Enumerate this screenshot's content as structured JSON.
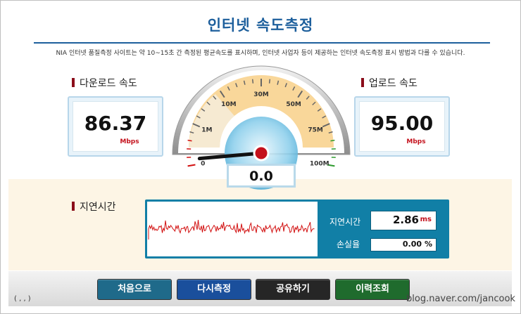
{
  "page": {
    "title": "인터넷 속도측정",
    "description": "NIA 인터넷 품질측정 사이트는 약 10~15초 간 측정된 평균속도를 표시하며, 인터넷 사업자 등이 제공하는 인터넷 속도측정 표시 방법과 다를 수 있습니다."
  },
  "download": {
    "label": "다운로드 속도",
    "value": "86.37",
    "unit": "Mbps"
  },
  "upload": {
    "label": "업로드 속도",
    "value": "95.00",
    "unit": "Mbps"
  },
  "gauge": {
    "ticks": [
      "0",
      "1M",
      "10M",
      "30M",
      "50M",
      "75M",
      "100M"
    ],
    "current_value": "0.0",
    "needle_level": 0.0
  },
  "latency": {
    "label": "지연시간",
    "stat_label": "지연시간",
    "value": "2.86",
    "unit": "ms",
    "loss_label": "손실율",
    "loss_value": "0.00",
    "loss_unit": "%"
  },
  "buttons": [
    {
      "label": "처음으로",
      "color": "#1f6a8a"
    },
    {
      "label": "다시측정",
      "color": "#1a4f9c"
    },
    {
      "label": "공유하기",
      "color": "#262626"
    },
    {
      "label": "이력조회",
      "color": "#1f6b2d"
    }
  ],
  "footer": {
    "coords": "( , , )",
    "watermark": "blog.naver.com/jancook"
  },
  "colors": {
    "title": "#1d5f9c",
    "accent_red": "#c4111c",
    "gauge_fill": "#f9d79a",
    "panel_blue": "#117fa6"
  }
}
